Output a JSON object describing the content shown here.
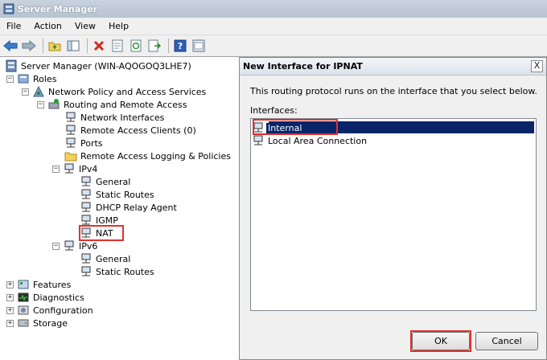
{
  "window": {
    "title": "Server Manager"
  },
  "menu": {
    "items": [
      "File",
      "Action",
      "View",
      "Help"
    ]
  },
  "toolbar": {
    "icons": [
      "back-icon",
      "forward-icon",
      "up-folder-icon",
      "show-hide-tree-icon",
      "delete-icon",
      "properties-icon",
      "refresh-icon",
      "export-list-icon",
      "help-icon",
      "console-icon"
    ]
  },
  "tree": {
    "root": "Server Manager (WIN-AQOGOQ3LHE7)",
    "roles": "Roles",
    "npas": "Network Policy and Access Services",
    "rras": "Routing and Remote Access",
    "network_interfaces": "Network Interfaces",
    "remote_access_clients": "Remote Access Clients (0)",
    "ports": "Ports",
    "logging": "Remote Access Logging & Policies",
    "ipv4": "IPv4",
    "ipv4_general": "General",
    "ipv4_static_routes": "Static Routes",
    "dhcp_relay": "DHCP Relay Agent",
    "igmp": "IGMP",
    "nat": "NAT",
    "ipv6": "IPv6",
    "ipv6_general": "General",
    "ipv6_static_routes": "Static Routes",
    "features": "Features",
    "diagnostics": "Diagnostics",
    "configuration": "Configuration",
    "storage": "Storage"
  },
  "dialog": {
    "title": "New Interface for IPNAT",
    "close_glyph": "X",
    "description": "This routing protocol runs on the interface that you select below.",
    "interfaces_label": "Interfaces:",
    "interfaces": [
      {
        "name": "Internal",
        "selected": true
      },
      {
        "name": "Local Area Connection",
        "selected": false
      }
    ],
    "ok_label": "OK",
    "cancel_label": "Cancel"
  },
  "colors": {
    "highlight_box": "#e0312b",
    "selection": "#0a246a"
  }
}
